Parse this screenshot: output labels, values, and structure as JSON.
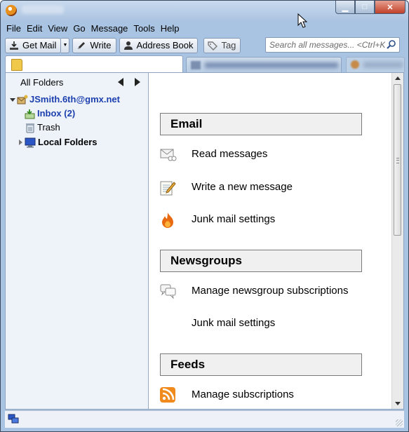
{
  "window": {
    "controls": {
      "minimize": "▁",
      "maximize": "□",
      "close": "✕"
    }
  },
  "menu": [
    "File",
    "Edit",
    "View",
    "Go",
    "Message",
    "Tools",
    "Help"
  ],
  "toolbar": {
    "get_mail": "Get Mail",
    "write": "Write",
    "address_book": "Address Book",
    "tag": "Tag",
    "search_placeholder": "Search all messages... <Ctrl+K>"
  },
  "folder_pane": {
    "title": "All Folders",
    "account": "JSmith.6th@gmx.net",
    "inbox": "Inbox (2)",
    "trash": "Trash",
    "local_folders": "Local Folders"
  },
  "main": {
    "sections": [
      {
        "header": "Email",
        "actions": [
          {
            "label": "Read messages",
            "icon": "envelope-icon"
          },
          {
            "label": "Write a new message",
            "icon": "compose-icon"
          },
          {
            "label": "Junk mail settings",
            "icon": "junk-flame-icon"
          }
        ]
      },
      {
        "header": "Newsgroups",
        "actions": [
          {
            "label": "Manage newsgroup subscriptions",
            "icon": "newsgroup-icon"
          },
          {
            "label": "Junk mail settings",
            "icon": ""
          }
        ]
      },
      {
        "header": "Feeds",
        "actions": [
          {
            "label": "Manage subscriptions",
            "icon": "rss-icon"
          }
        ]
      }
    ]
  },
  "colors": {
    "frame": "#a9c4e2",
    "account_text": "#1c3fae",
    "rss_orange": "#f08a1c",
    "flame_orange": "#e86a10"
  }
}
